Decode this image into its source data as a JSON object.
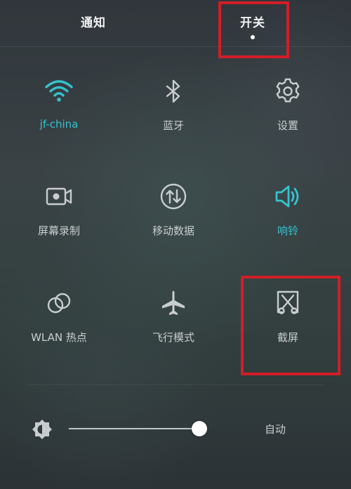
{
  "tabs": [
    {
      "label": "通知"
    },
    {
      "label": "开关",
      "selected": true
    }
  ],
  "toggles": [
    {
      "label": "jf-china",
      "icon": "wifi-icon",
      "active": true
    },
    {
      "label": "蓝牙",
      "icon": "bluetooth-icon",
      "active": false
    },
    {
      "label": "设置",
      "icon": "gear-icon",
      "active": false
    },
    {
      "label": "屏幕录制",
      "icon": "screen-record-icon",
      "active": false
    },
    {
      "label": "移动数据",
      "icon": "mobile-data-icon",
      "active": false
    },
    {
      "label": "响铃",
      "icon": "ringer-icon",
      "active": true
    },
    {
      "label": "WLAN 热点",
      "icon": "hotspot-icon",
      "active": false
    },
    {
      "label": "飞行模式",
      "icon": "airplane-icon",
      "active": false
    },
    {
      "label": "截屏",
      "icon": "screenshot-icon",
      "active": false
    }
  ],
  "brightness": {
    "icon": "brightness-icon",
    "level": 0.98,
    "auto_label": "自动"
  },
  "colors": {
    "accent": "#35c2cf",
    "highlight_box": "#d21e27",
    "label": "#c9cdce"
  }
}
